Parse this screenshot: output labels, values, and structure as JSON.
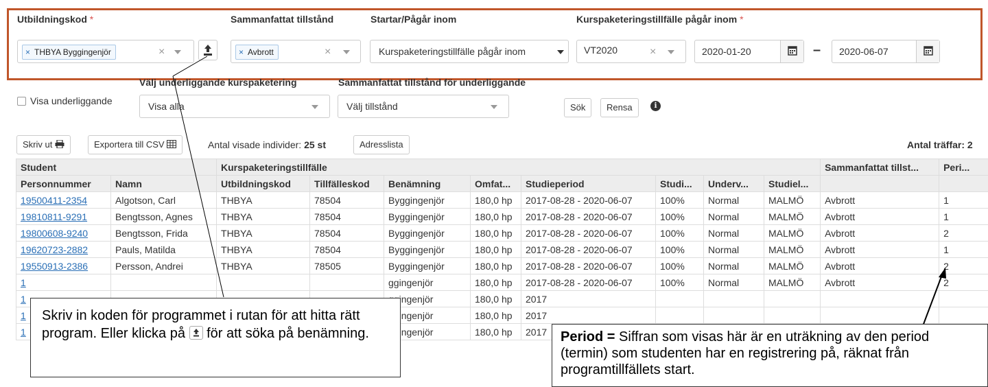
{
  "filters": {
    "utbildningskod": {
      "label": "Utbildningskod",
      "required_mark": "*",
      "tag": "THBYA Byggingenjör",
      "tag_remove": "×",
      "clear": "×"
    },
    "sammanfattat": {
      "label": "Sammanfattat tillstånd",
      "tag": "Avbrott",
      "tag_remove": "×",
      "clear": "×"
    },
    "startar": {
      "label": "Startar/Pågår inom",
      "value": "Kurspaketeringstillfälle pågår inom"
    },
    "pagar": {
      "label": "Kurspaketeringstillfälle pågår inom",
      "required_mark": "*",
      "term": "VT2020",
      "clear": "×",
      "from": "2020-01-20",
      "dash": "–",
      "to": "2020-06-07"
    }
  },
  "underliggande": {
    "checkbox_label": "Visa underliggande",
    "kurs_label": "Välj underliggande kurspaketering",
    "kurs_value": "Visa alla",
    "tillstand_label": "Sammanfattat tillstånd för underliggande",
    "tillstand_value": "Välj tillstånd",
    "search": "Sök",
    "reset": "Rensa",
    "info": "ℹ"
  },
  "toolbar": {
    "print": "Skriv ut",
    "export": "Exportera till CSV",
    "count_label": "Antal visade individer:",
    "count_value": "25 st",
    "address_list": "Adresslista",
    "hits": "Antal träffar: 2"
  },
  "table": {
    "group_headers": [
      "Student",
      "Kurspaketeringstillfälle",
      "Sammanfattat tillst...",
      "Peri..."
    ],
    "columns": [
      "Personnummer",
      "Namn",
      "Utbildningskod",
      "Tillfälleskod",
      "Benämning",
      "Omfat...",
      "Studieperiod",
      "Studi...",
      "Underv...",
      "Studiel...",
      "",
      ""
    ],
    "rows": [
      [
        "19500411-2354",
        "Algotson, Carl",
        "THBYA",
        "78504",
        "Byggingenjör",
        "180,0 hp",
        "2017-08-28 - 2020-06-07",
        "100%",
        "Normal",
        "MALMÖ",
        "Avbrott",
        "1"
      ],
      [
        "19810811-9291",
        "Bengtsson, Agnes",
        "THBYA",
        "78504",
        "Byggingenjör",
        "180,0 hp",
        "2017-08-28 - 2020-06-07",
        "100%",
        "Normal",
        "MALMÖ",
        "Avbrott",
        "1"
      ],
      [
        "19800608-9240",
        "Bengtsson, Frida",
        "THBYA",
        "78504",
        "Byggingenjör",
        "180,0 hp",
        "2017-08-28 - 2020-06-07",
        "100%",
        "Normal",
        "MALMÖ",
        "Avbrott",
        "2"
      ],
      [
        "19620723-2882",
        "Pauls, Matilda",
        "THBYA",
        "78504",
        "Byggingenjör",
        "180,0 hp",
        "2017-08-28 - 2020-06-07",
        "100%",
        "Normal",
        "MALMÖ",
        "Avbrott",
        "1"
      ],
      [
        "19550913-2386",
        "Persson, Andrei",
        "THBYA",
        "78505",
        "Byggingenjör",
        "180,0 hp",
        "2017-08-28 - 2020-06-07",
        "100%",
        "Normal",
        "MALMÖ",
        "Avbrott",
        "2"
      ],
      [
        "1",
        "",
        "",
        "",
        "ggingenjör",
        "180,0 hp",
        "2017-08-28 - 2020-06-07",
        "100%",
        "Normal",
        "MALMÖ",
        "Avbrott",
        "2"
      ],
      [
        "1",
        "",
        "",
        "",
        "ggingenjör",
        "180,0 hp",
        "2017",
        "",
        "",
        "",
        "",
        ""
      ],
      [
        "1",
        "",
        "",
        "",
        "ggingenjör",
        "180,0 hp",
        "2017",
        "",
        "",
        "",
        "",
        ""
      ],
      [
        "1",
        "",
        "",
        "",
        "ggingenjör",
        "180,0 hp",
        "2017",
        "",
        "",
        "",
        "",
        ""
      ]
    ]
  },
  "callouts": {
    "left": {
      "part1": "Skriv in koden för programmet i rutan för att hitta rätt program. Eller klicka på",
      "part2": "för att söka på benämning."
    },
    "right": {
      "bold": "Period =",
      "text": "Siffran som visas här är en uträkning av den period (termin) som studenten har en registrering på, räknat från programtillfällets start."
    }
  },
  "colors": {
    "highlight_frame": "#c0562a",
    "link": "#2a6fb6",
    "required": "#d9534f"
  }
}
